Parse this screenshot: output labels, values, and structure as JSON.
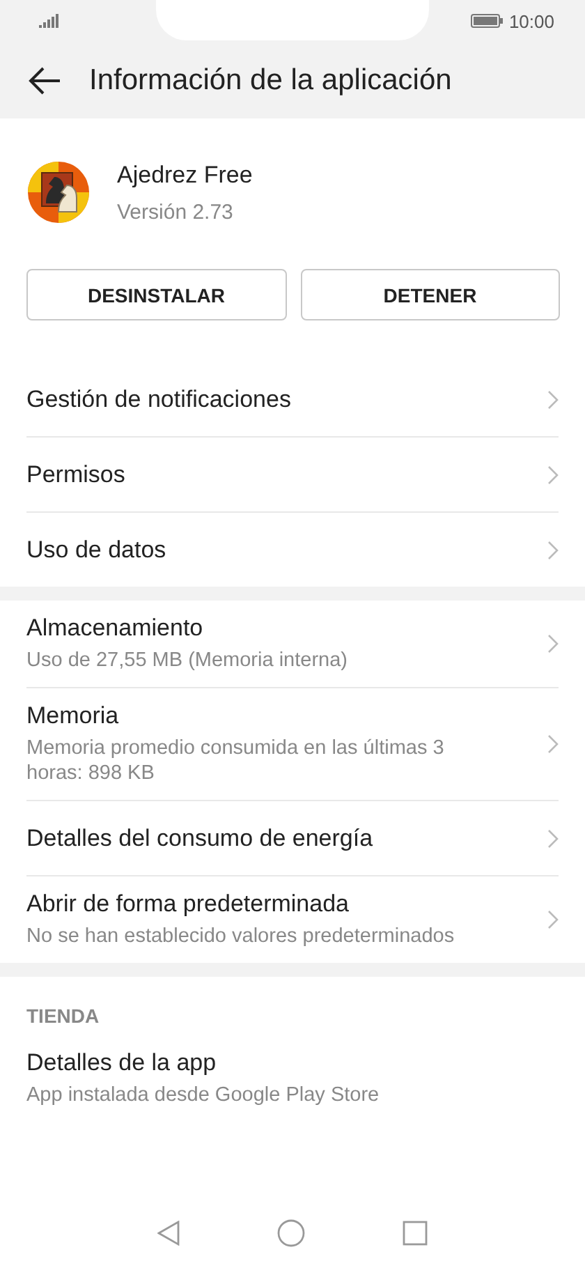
{
  "status_bar": {
    "time": "10:00"
  },
  "app_bar": {
    "title": "Información de la aplicación"
  },
  "app": {
    "name": "Ajedrez Free",
    "version": "Versión 2.73"
  },
  "buttons": [
    "DESINSTALAR",
    "DETENER"
  ],
  "sections": [
    {
      "items": [
        {
          "title": "Gestión de notificaciones",
          "chevron": true
        },
        {
          "title": "Permisos",
          "chevron": true
        },
        {
          "title": "Uso de datos",
          "chevron": true
        }
      ]
    },
    {
      "items": [
        {
          "title": "Almacenamiento",
          "subtitle": "Uso de 27,55 MB (Memoria interna)",
          "chevron": true
        },
        {
          "title": "Memoria",
          "subtitle": "Memoria promedio consumida en las últimas 3 horas: 898 KB",
          "chevron": true
        },
        {
          "title": "Detalles del consumo de energía",
          "chevron": true
        },
        {
          "title": "Abrir de forma predeterminada",
          "subtitle": "No se han establecido valores predeterminados",
          "chevron": true
        }
      ]
    },
    {
      "header": "TIENDA",
      "items": [
        {
          "title": "Detalles de la app",
          "subtitle": "App instalada desde Google Play Store",
          "chevron": false
        }
      ]
    }
  ]
}
